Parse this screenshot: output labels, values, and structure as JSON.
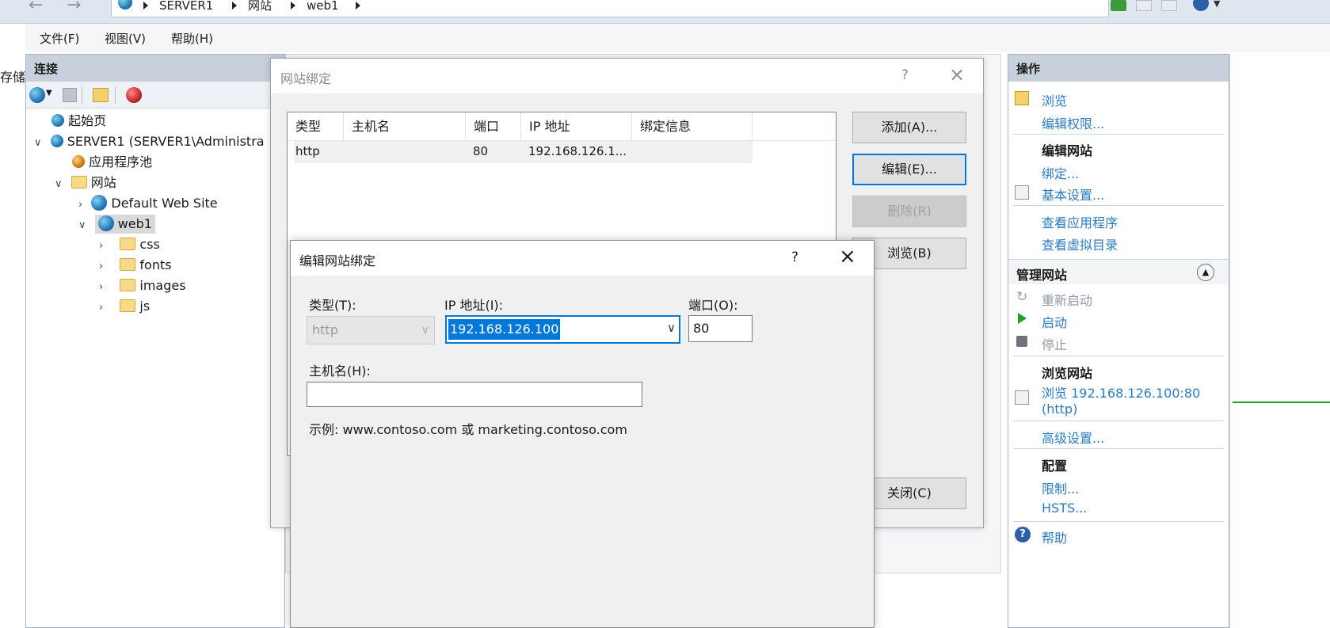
{
  "breadcrumb": {
    "items": [
      "SERVER1",
      "网站",
      "web1"
    ]
  },
  "menu": [
    "文件(F)",
    "视图(V)",
    "帮助(H)"
  ],
  "left_edge_text": "存储",
  "connections": {
    "title": "连接",
    "tree": [
      {
        "label": "起始页"
      },
      {
        "label": "SERVER1 (SERVER1\\Administra"
      },
      {
        "label": "应用程序池"
      },
      {
        "label": "网站"
      },
      {
        "label": "Default Web Site"
      },
      {
        "label": "web1"
      },
      {
        "label": "css"
      },
      {
        "label": "fonts"
      },
      {
        "label": "images"
      },
      {
        "label": "js"
      }
    ]
  },
  "actions": {
    "title": "操作",
    "browse": "浏览",
    "edit_permissions": "编辑权限...",
    "edit_site_head": "编辑网站",
    "bindings": "绑定...",
    "basic_settings": "基本设置...",
    "view_apps": "查看应用程序",
    "view_vdirs": "查看虚拟目录",
    "manage_site_head": "管理网站",
    "restart": "重新启动",
    "start": "启动",
    "stop": "停止",
    "browse_site_head": "浏览网站",
    "browse_link_1": "浏览 192.168.126.100:80",
    "browse_link_2": "(http)",
    "advanced": "高级设置...",
    "config_head": "配置",
    "limits": "限制...",
    "hsts": "HSTS...",
    "help": "帮助"
  },
  "bindings_dialog": {
    "title": "网站绑定",
    "help_glyph": "?",
    "columns": [
      "类型",
      "主机名",
      "端口",
      "IP 地址",
      "绑定信息"
    ],
    "rows": [
      [
        "http",
        "",
        "80",
        "192.168.126.1...",
        ""
      ]
    ],
    "buttons": {
      "add": "添加(A)...",
      "edit": "编辑(E)...",
      "remove": "删除(R)",
      "browse": "浏览(B)",
      "close": "关闭(C)"
    }
  },
  "edit_dialog": {
    "title": "编辑网站绑定",
    "help_glyph": "?",
    "type_label": "类型(T):",
    "type_value": "http",
    "ip_label": "IP 地址(I):",
    "ip_value": "192.168.126.100",
    "port_label": "端口(O):",
    "port_value": "80",
    "host_label": "主机名(H):",
    "host_value": "",
    "example": "示例: www.contoso.com 或 marketing.contoso.com"
  },
  "colors": {
    "link": "#2b7bc0",
    "focus": "#0078d7",
    "selection": "#0078d7"
  }
}
